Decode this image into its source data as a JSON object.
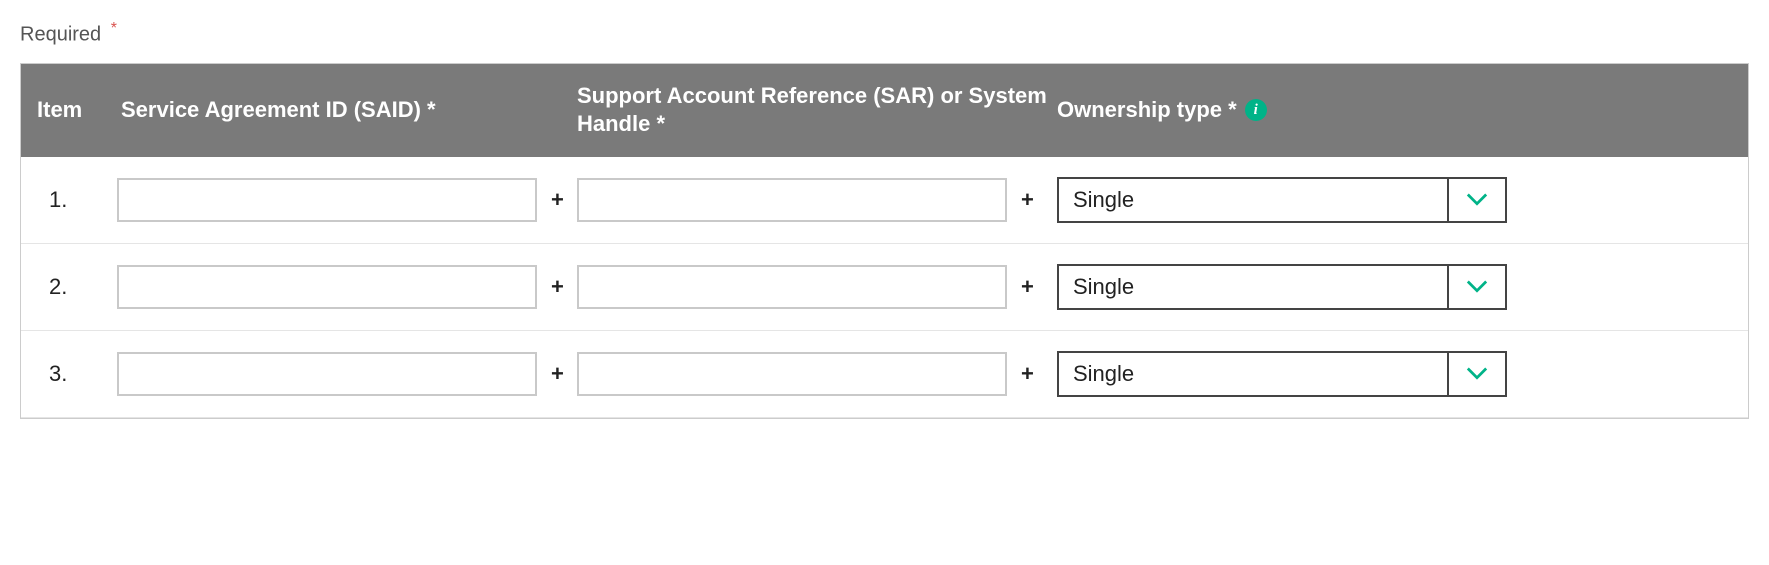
{
  "labels": {
    "required": "Required",
    "asterisk": "*"
  },
  "headers": {
    "item": "Item",
    "said": "Service Agreement ID (SAID) *",
    "sar": "Support Account Reference (SAR) or System Handle *",
    "ownership": "Ownership type *"
  },
  "icons": {
    "info_glyph": "i"
  },
  "symbols": {
    "plus": "+"
  },
  "rows": [
    {
      "num": "1.",
      "said": "",
      "sar": "",
      "ownership": "Single"
    },
    {
      "num": "2.",
      "said": "",
      "sar": "",
      "ownership": "Single"
    },
    {
      "num": "3.",
      "said": "",
      "sar": "",
      "ownership": "Single"
    }
  ],
  "colors": {
    "accent": "#00b388",
    "header_bg": "#7a7a7a",
    "required_asterisk": "#d9534f"
  }
}
